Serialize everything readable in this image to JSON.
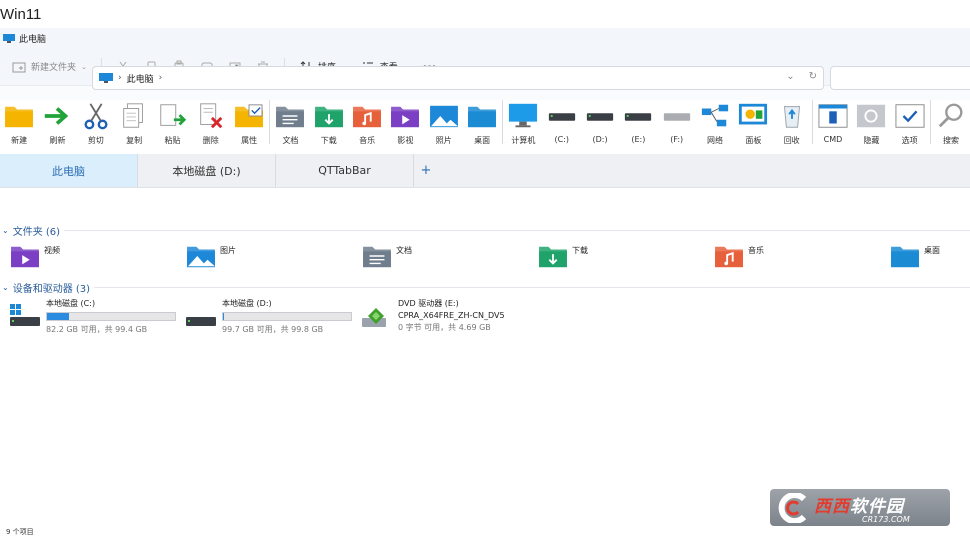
{
  "caption": "Win11",
  "window": {
    "title": "此电脑"
  },
  "command_bar": {
    "new_label": "新建文件夹",
    "sort_label": "排序",
    "view_label": "查看",
    "more_label": "···"
  },
  "address": {
    "crumbs": [
      "此电脑"
    ]
  },
  "qt_toolbar": {
    "items": [
      {
        "label": "新建",
        "icon": "new-folder-icon"
      },
      {
        "label": "刷新",
        "icon": "refresh-icon"
      },
      {
        "label": "剪切",
        "icon": "scissors-icon"
      },
      {
        "label": "复制",
        "icon": "copy-icon"
      },
      {
        "label": "粘贴",
        "icon": "paste-icon"
      },
      {
        "label": "删除",
        "icon": "delete-icon"
      },
      {
        "label": "属性",
        "icon": "properties-icon"
      },
      {
        "label": "文档",
        "icon": "documents-icon"
      },
      {
        "label": "下载",
        "icon": "downloads-icon"
      },
      {
        "label": "音乐",
        "icon": "music-icon"
      },
      {
        "label": "影视",
        "icon": "video-icon"
      },
      {
        "label": "照片",
        "icon": "pictures-icon"
      },
      {
        "label": "桌面",
        "icon": "desktop-icon"
      },
      {
        "label": "计算机",
        "icon": "computer-icon"
      },
      {
        "label": "(C:)",
        "icon": "drive-c-icon"
      },
      {
        "label": "(D:)",
        "icon": "drive-d-icon"
      },
      {
        "label": "(E:)",
        "icon": "drive-e-icon"
      },
      {
        "label": "(F:)",
        "icon": "drive-f-icon"
      },
      {
        "label": "网络",
        "icon": "network-icon"
      },
      {
        "label": "面板",
        "icon": "control-panel-icon"
      },
      {
        "label": "回收",
        "icon": "recycle-bin-icon"
      },
      {
        "label": "CMD",
        "icon": "cmd-icon"
      },
      {
        "label": "隐藏",
        "icon": "hide-icon"
      },
      {
        "label": "选项",
        "icon": "options-icon"
      },
      {
        "label": "搜索",
        "icon": "search-icon"
      }
    ]
  },
  "tabs": [
    {
      "label": "此电脑",
      "active": true
    },
    {
      "label": "本地磁盘 (D:)",
      "active": false
    },
    {
      "label": "QTTabBar",
      "active": false
    }
  ],
  "tab_add": "+",
  "folders_section": {
    "header": "文件夹 (6)",
    "items": [
      {
        "name": "视频",
        "icon": "video-folder-icon",
        "color": "#7b3fc4"
      },
      {
        "name": "图片",
        "icon": "pictures-folder-icon",
        "color": "#1e88d8"
      },
      {
        "name": "文档",
        "icon": "documents-folder-icon",
        "color": "#6f7d8c"
      },
      {
        "name": "下载",
        "icon": "downloads-folder-icon",
        "color": "#1fa36b"
      },
      {
        "name": "音乐",
        "icon": "music-folder-icon",
        "color": "#e7603c"
      },
      {
        "name": "桌面",
        "icon": "desktop-folder-icon",
        "color": "#1b8bd4"
      }
    ]
  },
  "drives_section": {
    "header": "设备和驱动器 (3)",
    "items": [
      {
        "name": "本地磁盘 (C:)",
        "line2": "",
        "usage": 0.17,
        "sub": "82.2 GB 可用，共 99.4 GB",
        "icon": "windows-drive-icon"
      },
      {
        "name": "本地磁盘 (D:)",
        "line2": "",
        "usage": 0.001,
        "sub": "99.7 GB 可用，共 99.8 GB",
        "icon": "drive-icon"
      },
      {
        "name": "DVD 驱动器 (E:)",
        "line2": "CPRA_X64FRE_ZH-CN_DV5",
        "usage": null,
        "sub": "0 字节 可用，共 4.69 GB",
        "icon": "dvd-drive-icon"
      }
    ]
  },
  "status": {
    "count": "9 个项目"
  },
  "watermark": {
    "title_a": "西西",
    "title_b": "软件园",
    "url": "CR173.COM"
  }
}
